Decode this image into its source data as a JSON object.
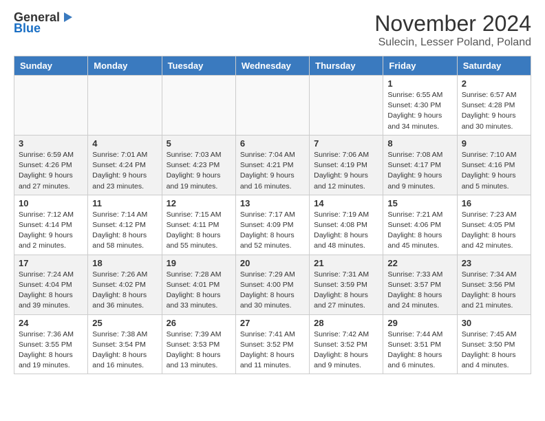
{
  "header": {
    "logo_line1": "General",
    "logo_line2": "Blue",
    "title": "November 2024",
    "subtitle": "Sulecin, Lesser Poland, Poland"
  },
  "days_of_week": [
    "Sunday",
    "Monday",
    "Tuesday",
    "Wednesday",
    "Thursday",
    "Friday",
    "Saturday"
  ],
  "weeks": [
    [
      {
        "day": "",
        "info": ""
      },
      {
        "day": "",
        "info": ""
      },
      {
        "day": "",
        "info": ""
      },
      {
        "day": "",
        "info": ""
      },
      {
        "day": "",
        "info": ""
      },
      {
        "day": "1",
        "info": "Sunrise: 6:55 AM\nSunset: 4:30 PM\nDaylight: 9 hours and 34 minutes."
      },
      {
        "day": "2",
        "info": "Sunrise: 6:57 AM\nSunset: 4:28 PM\nDaylight: 9 hours and 30 minutes."
      }
    ],
    [
      {
        "day": "3",
        "info": "Sunrise: 6:59 AM\nSunset: 4:26 PM\nDaylight: 9 hours and 27 minutes."
      },
      {
        "day": "4",
        "info": "Sunrise: 7:01 AM\nSunset: 4:24 PM\nDaylight: 9 hours and 23 minutes."
      },
      {
        "day": "5",
        "info": "Sunrise: 7:03 AM\nSunset: 4:23 PM\nDaylight: 9 hours and 19 minutes."
      },
      {
        "day": "6",
        "info": "Sunrise: 7:04 AM\nSunset: 4:21 PM\nDaylight: 9 hours and 16 minutes."
      },
      {
        "day": "7",
        "info": "Sunrise: 7:06 AM\nSunset: 4:19 PM\nDaylight: 9 hours and 12 minutes."
      },
      {
        "day": "8",
        "info": "Sunrise: 7:08 AM\nSunset: 4:17 PM\nDaylight: 9 hours and 9 minutes."
      },
      {
        "day": "9",
        "info": "Sunrise: 7:10 AM\nSunset: 4:16 PM\nDaylight: 9 hours and 5 minutes."
      }
    ],
    [
      {
        "day": "10",
        "info": "Sunrise: 7:12 AM\nSunset: 4:14 PM\nDaylight: 9 hours and 2 minutes."
      },
      {
        "day": "11",
        "info": "Sunrise: 7:14 AM\nSunset: 4:12 PM\nDaylight: 8 hours and 58 minutes."
      },
      {
        "day": "12",
        "info": "Sunrise: 7:15 AM\nSunset: 4:11 PM\nDaylight: 8 hours and 55 minutes."
      },
      {
        "day": "13",
        "info": "Sunrise: 7:17 AM\nSunset: 4:09 PM\nDaylight: 8 hours and 52 minutes."
      },
      {
        "day": "14",
        "info": "Sunrise: 7:19 AM\nSunset: 4:08 PM\nDaylight: 8 hours and 48 minutes."
      },
      {
        "day": "15",
        "info": "Sunrise: 7:21 AM\nSunset: 4:06 PM\nDaylight: 8 hours and 45 minutes."
      },
      {
        "day": "16",
        "info": "Sunrise: 7:23 AM\nSunset: 4:05 PM\nDaylight: 8 hours and 42 minutes."
      }
    ],
    [
      {
        "day": "17",
        "info": "Sunrise: 7:24 AM\nSunset: 4:04 PM\nDaylight: 8 hours and 39 minutes."
      },
      {
        "day": "18",
        "info": "Sunrise: 7:26 AM\nSunset: 4:02 PM\nDaylight: 8 hours and 36 minutes."
      },
      {
        "day": "19",
        "info": "Sunrise: 7:28 AM\nSunset: 4:01 PM\nDaylight: 8 hours and 33 minutes."
      },
      {
        "day": "20",
        "info": "Sunrise: 7:29 AM\nSunset: 4:00 PM\nDaylight: 8 hours and 30 minutes."
      },
      {
        "day": "21",
        "info": "Sunrise: 7:31 AM\nSunset: 3:59 PM\nDaylight: 8 hours and 27 minutes."
      },
      {
        "day": "22",
        "info": "Sunrise: 7:33 AM\nSunset: 3:57 PM\nDaylight: 8 hours and 24 minutes."
      },
      {
        "day": "23",
        "info": "Sunrise: 7:34 AM\nSunset: 3:56 PM\nDaylight: 8 hours and 21 minutes."
      }
    ],
    [
      {
        "day": "24",
        "info": "Sunrise: 7:36 AM\nSunset: 3:55 PM\nDaylight: 8 hours and 19 minutes."
      },
      {
        "day": "25",
        "info": "Sunrise: 7:38 AM\nSunset: 3:54 PM\nDaylight: 8 hours and 16 minutes."
      },
      {
        "day": "26",
        "info": "Sunrise: 7:39 AM\nSunset: 3:53 PM\nDaylight: 8 hours and 13 minutes."
      },
      {
        "day": "27",
        "info": "Sunrise: 7:41 AM\nSunset: 3:52 PM\nDaylight: 8 hours and 11 minutes."
      },
      {
        "day": "28",
        "info": "Sunrise: 7:42 AM\nSunset: 3:52 PM\nDaylight: 8 hours and 9 minutes."
      },
      {
        "day": "29",
        "info": "Sunrise: 7:44 AM\nSunset: 3:51 PM\nDaylight: 8 hours and 6 minutes."
      },
      {
        "day": "30",
        "info": "Sunrise: 7:45 AM\nSunset: 3:50 PM\nDaylight: 8 hours and 4 minutes."
      }
    ]
  ]
}
